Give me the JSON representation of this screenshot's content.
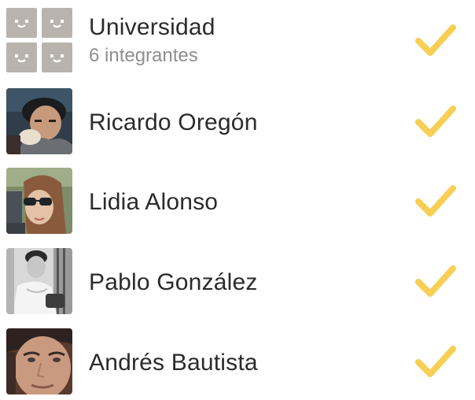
{
  "accent_color": "#f7cf55",
  "group": {
    "name": "Universidad",
    "subtitle": "6 integrantes",
    "icon": "group-faces-icon",
    "selected": true
  },
  "contacts": [
    {
      "name": "Ricardo Oregón",
      "selected": true
    },
    {
      "name": "Lidia Alonso",
      "selected": true
    },
    {
      "name": "Pablo González",
      "selected": true
    },
    {
      "name": "Andrés Bautista",
      "selected": true
    }
  ],
  "icons": {
    "selected": "checkmark-icon",
    "placeholder": "smiley-face-icon"
  }
}
